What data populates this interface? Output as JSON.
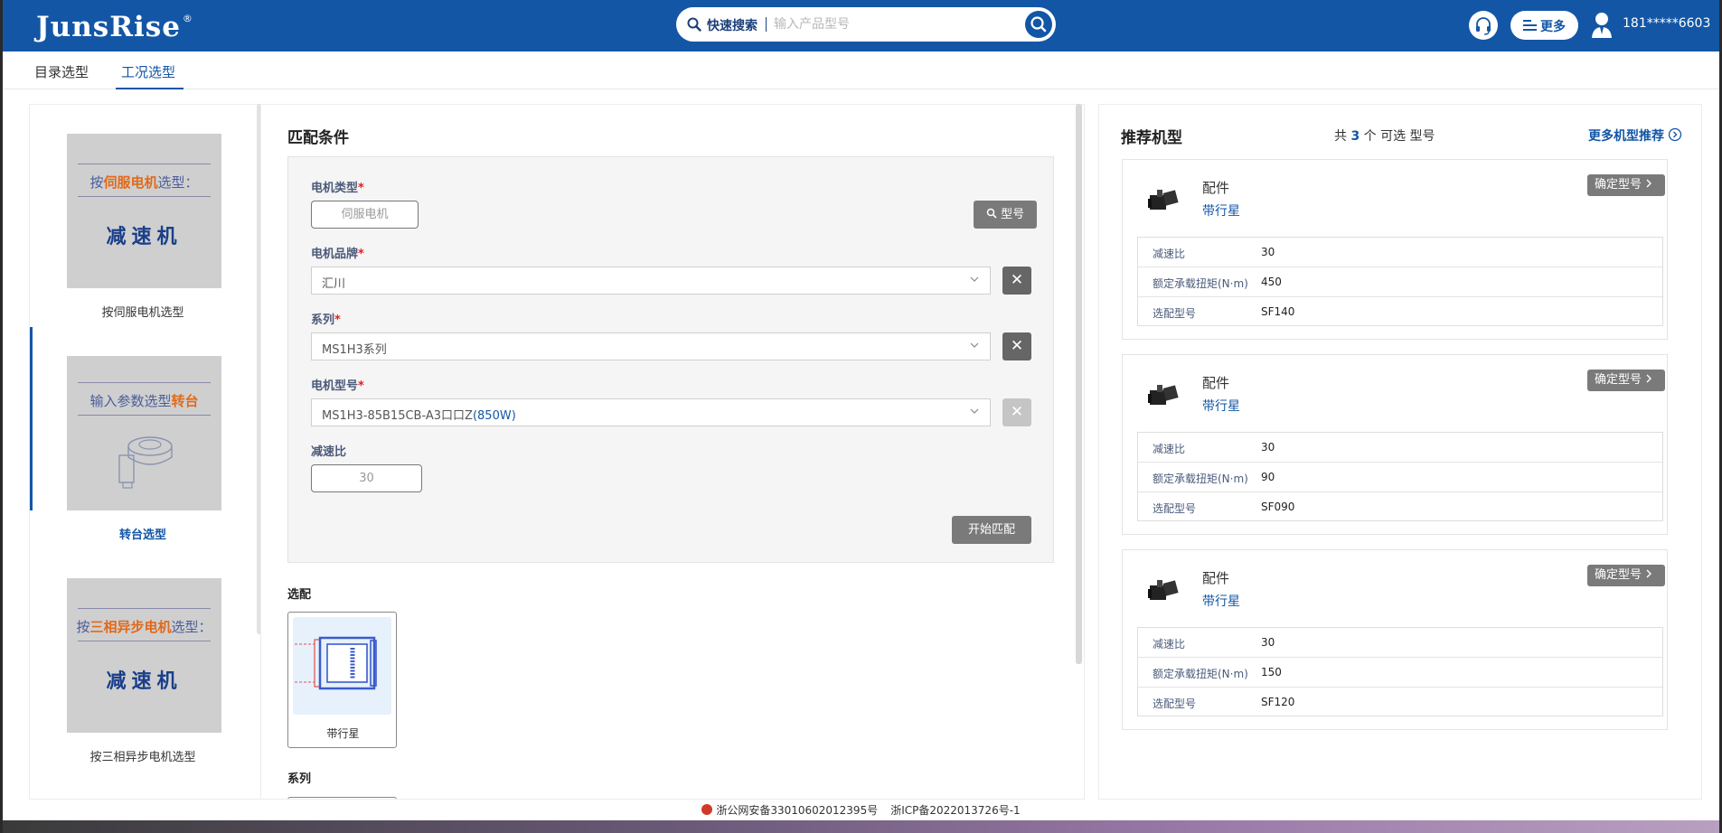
{
  "header": {
    "logo": "JunsRise",
    "logo_mark": "®",
    "search_label": "快速搜索",
    "search_placeholder": "输入产品型号",
    "more_label": "更多",
    "user": "181*****6603",
    "icons": [
      "search-icon",
      "headset-icon",
      "menu-icon",
      "user-avatar-icon"
    ]
  },
  "tabs": [
    {
      "label": "目录选型",
      "active": false
    },
    {
      "label": "工况选型",
      "active": true
    }
  ],
  "left": {
    "cards": [
      {
        "img_line": [
          "按",
          "伺服电机",
          "选型："
        ],
        "img_big": "减速机",
        "caption": "按伺服电机选型",
        "active": false
      },
      {
        "img_line": [
          "输入参数选型",
          "转台",
          ""
        ],
        "img_big": "",
        "caption": "转台选型",
        "active": true
      },
      {
        "img_line": [
          "按",
          "三相异步电机",
          "选型："
        ],
        "img_big": "减速机",
        "caption": "按三相异步电机选型",
        "active": false
      }
    ]
  },
  "match": {
    "title": "匹配条件",
    "motor_type": {
      "label": "电机类型",
      "value": "伺服电机"
    },
    "model_button": "型号",
    "brand": {
      "label": "电机品牌",
      "value": "汇川"
    },
    "series": {
      "label": "系列",
      "value": "MS1H3系列"
    },
    "motor_model": {
      "label": "电机型号",
      "value_main": "MS1H3-85B15CB-A3口口Z",
      "value_power": "(850W)"
    },
    "ratio": {
      "label": "减速比",
      "value": "30"
    },
    "start_button": "开始匹配",
    "required_mark": "*",
    "clear_glyph": "✕",
    "options_title": "选配",
    "option_caption": "带行星",
    "series_title": "系列"
  },
  "recommend": {
    "title": "推荐机型",
    "count_prefix": "共",
    "count": "3",
    "count_suffix": "个 可选 型号",
    "more_link": "更多机型推荐",
    "confirm_label": "确定型号",
    "cards": [
      {
        "kind": "配件",
        "sub": "带行星",
        "rows": [
          {
            "k": "减速比",
            "v": "30"
          },
          {
            "k": "额定承载扭矩(N·m)",
            "v": "450"
          },
          {
            "k": "选配型号",
            "v": "SF140"
          }
        ]
      },
      {
        "kind": "配件",
        "sub": "带行星",
        "rows": [
          {
            "k": "减速比",
            "v": "30"
          },
          {
            "k": "额定承载扭矩(N·m)",
            "v": "90"
          },
          {
            "k": "选配型号",
            "v": "SF090"
          }
        ]
      },
      {
        "kind": "配件",
        "sub": "带行星",
        "rows": [
          {
            "k": "减速比",
            "v": "30"
          },
          {
            "k": "额定承载扭矩(N·m)",
            "v": "150"
          },
          {
            "k": "选配型号",
            "v": "SF120"
          }
        ]
      }
    ]
  },
  "footer": {
    "police": "浙公网安备33010602012395号",
    "icp": "浙ICP备2022013726号-1"
  },
  "colors": {
    "brand": "#1356a5",
    "accent": "#e06a1a",
    "required": "#e02020"
  }
}
